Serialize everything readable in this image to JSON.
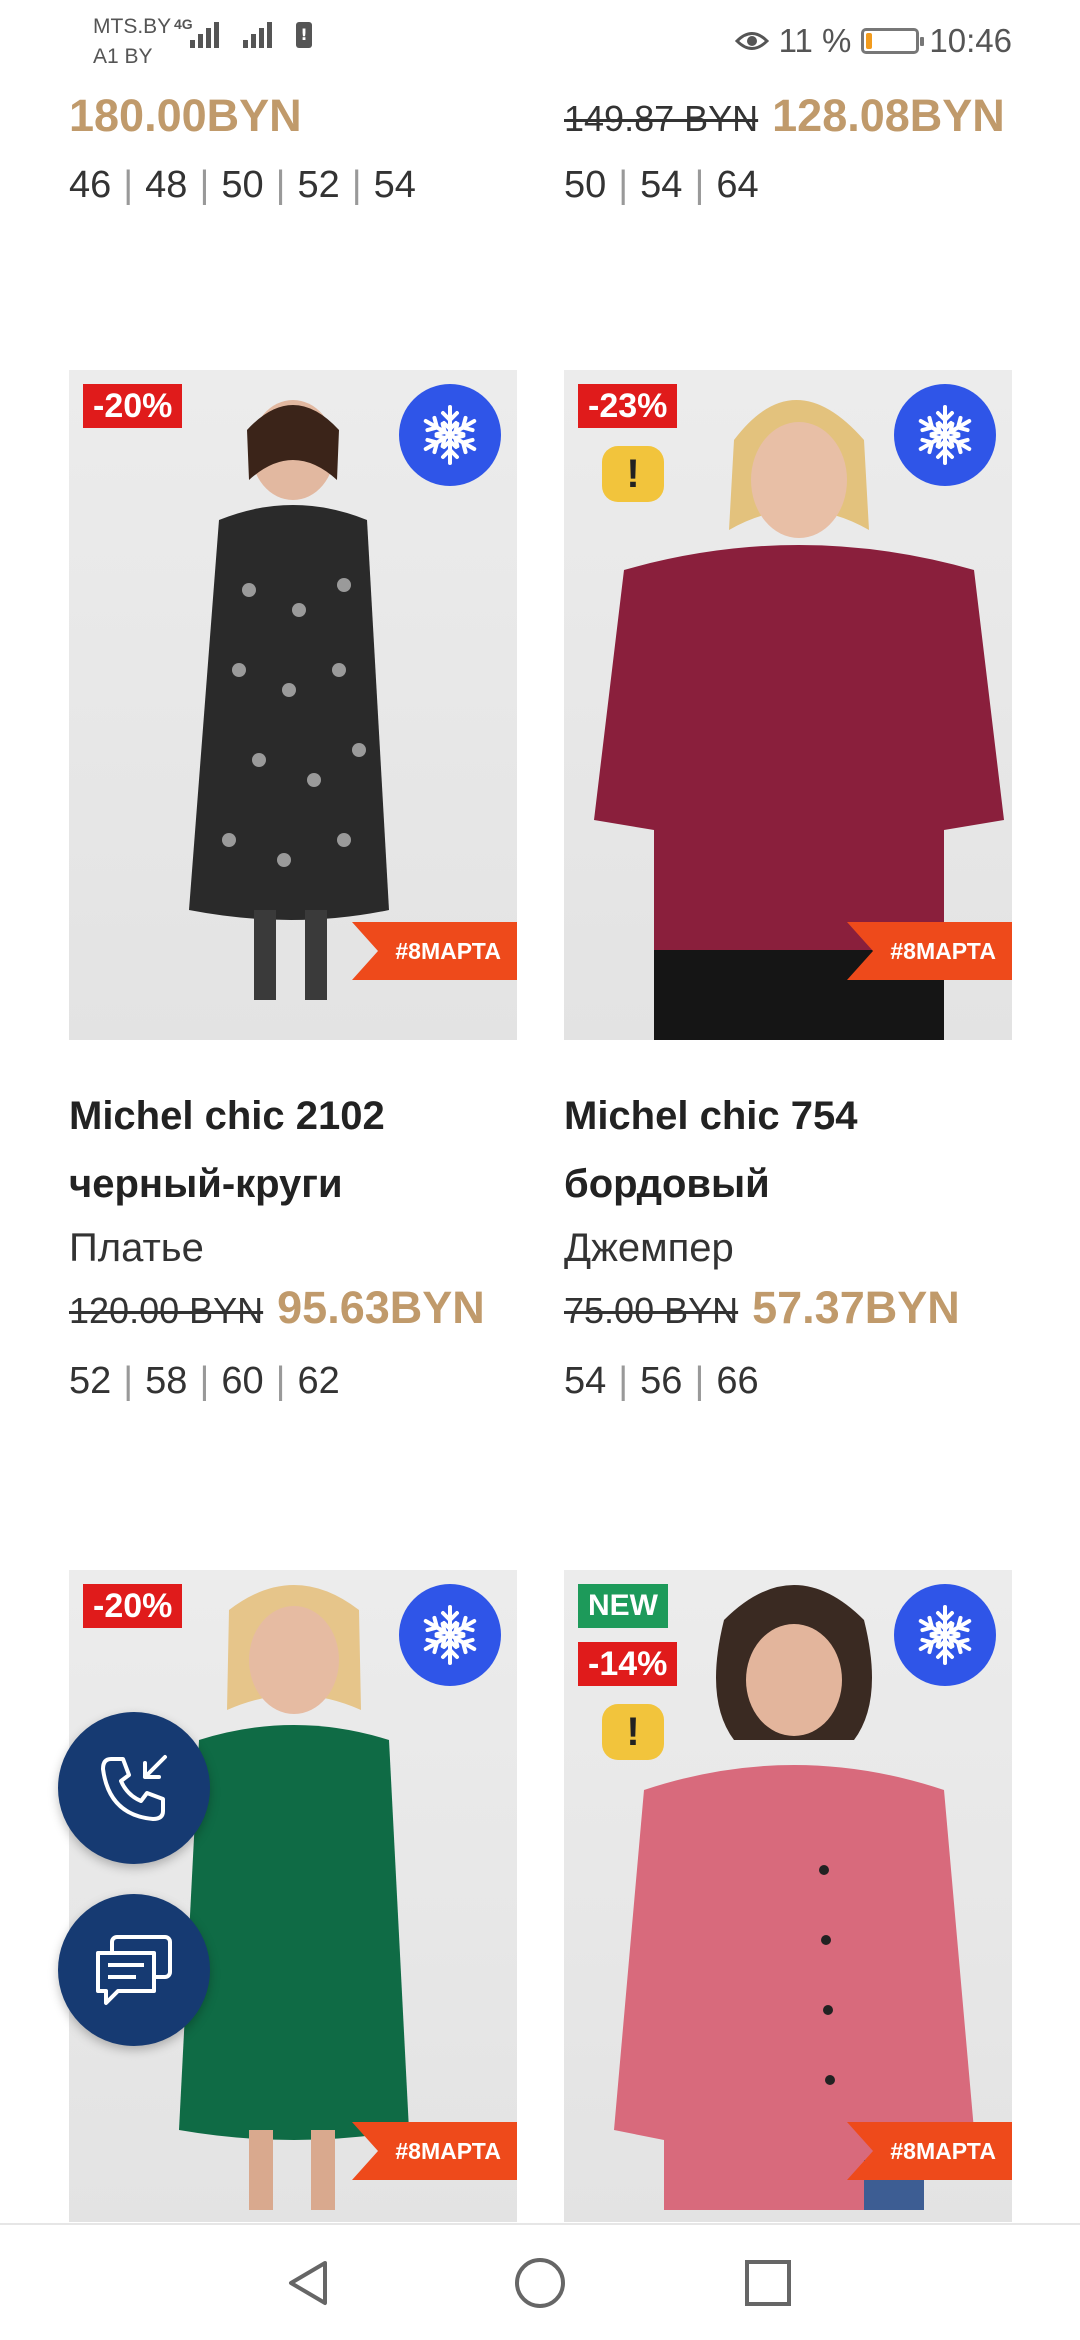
{
  "status_bar": {
    "carrier1": "MTS.BY",
    "carrier2": "A1 BY",
    "network": "4G",
    "battery_percent_text": "11 %",
    "battery_level": 0.11,
    "time": "10:46"
  },
  "top_row": [
    {
      "new_price": "180.00BYN",
      "old_price": "",
      "sizes": [
        "46",
        "48",
        "50",
        "52",
        "54"
      ]
    },
    {
      "old_price": "149.87 BYN",
      "new_price": "128.08BYN",
      "sizes": [
        "50",
        "54",
        "64"
      ]
    }
  ],
  "products": [
    {
      "discount": "-20%",
      "warning": false,
      "new_badge": "",
      "promo_tag": "#8МАРТА",
      "title_line1": "Michel chic 2102",
      "title_line2": "черный-круги",
      "category": "Платье",
      "old_price": "120.00 BYN",
      "new_price": "95.63BYN",
      "sizes": [
        "52",
        "58",
        "60",
        "62"
      ],
      "photo_color": "#2a2a2a"
    },
    {
      "discount": "-23%",
      "warning": true,
      "warning_symbol": "!",
      "new_badge": "",
      "promo_tag": "#8МАРТА",
      "title_line1": "Michel chic 754",
      "title_line2": "бордовый",
      "category": "Джемпер",
      "old_price": "75.00 BYN",
      "new_price": "57.37BYN",
      "sizes": [
        "54",
        "56",
        "66"
      ],
      "photo_color": "#8a1f3c"
    },
    {
      "discount": "-20%",
      "warning": false,
      "new_badge": "",
      "promo_tag": "#8МАРТА",
      "photo_color": "#0f6b45"
    },
    {
      "discount": "-14%",
      "warning": true,
      "warning_symbol": "!",
      "new_badge": "NEW",
      "promo_tag": "#8МАРТА",
      "photo_color": "#d86a7c"
    }
  ],
  "colors": {
    "price_accent": "#c09a6b",
    "discount_red": "#e01b1b",
    "promo_orange": "#ee4a1b",
    "snow_blue": "#2f55e8",
    "fab_navy": "#163a72",
    "new_green": "#1d9a5a",
    "warning_yellow": "#f2c43c"
  },
  "icons": {
    "call": "phone-callback-icon",
    "chat": "chat-bubbles-icon",
    "winter": "snowflake-icon",
    "nav_back": "triangle-back-icon",
    "nav_home": "circle-home-icon",
    "nav_recents": "square-recents-icon"
  }
}
